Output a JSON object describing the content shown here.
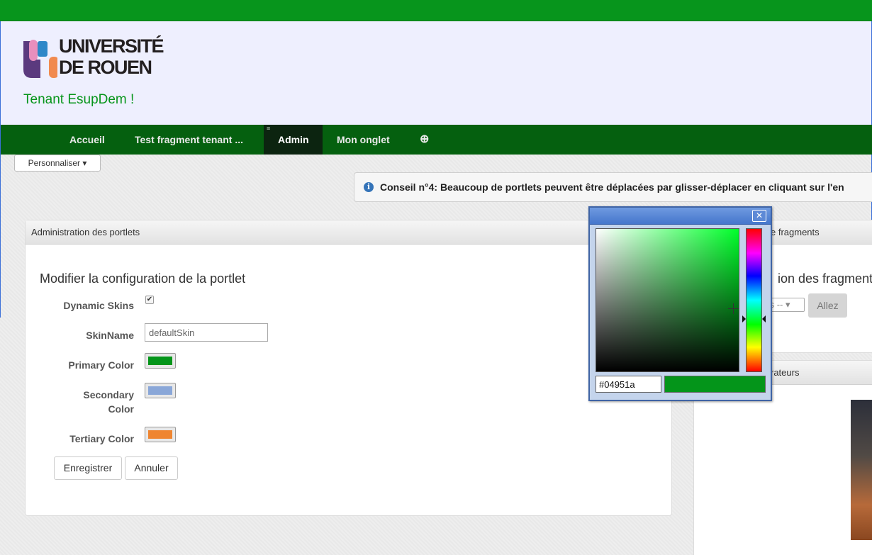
{
  "header": {
    "logo_line1": "UNIVERSITÉ",
    "logo_line2": "DE ROUEN",
    "tenant": "Tenant EsupDem !"
  },
  "nav": {
    "tabs": [
      {
        "label": "Accueil"
      },
      {
        "label": "Test fragment tenant ..."
      },
      {
        "label": "Admin",
        "active": true
      },
      {
        "label": "Mon onglet"
      },
      {
        "label": "⊕"
      }
    ]
  },
  "personalize_button": "Personnaliser ▾",
  "tip": "Conseil n°4: Beaucoup de portlets peuvent être déplacées par glisser-déplacer en cliquant sur l'en",
  "portlet_admin": {
    "header": "Administration des portlets",
    "title": "Modifier la configuration de la portlet",
    "fields": {
      "dynamic_skins": {
        "label": "Dynamic Skins",
        "checked": true
      },
      "skin_name": {
        "label": "SkinName",
        "value": "defaultSkin"
      },
      "primary_color": {
        "label": "Primary Color",
        "value": "#04951a"
      },
      "secondary_color": {
        "label": "Secondary Color",
        "value": "#8aa7d8"
      },
      "tertiary_color": {
        "label": "Tertiary Color",
        "value": "#ef8530"
      }
    },
    "save": "Enregistrer",
    "cancel": "Annuler"
  },
  "fragments_panel": {
    "header": "e fragments",
    "title": "ion des fragments",
    "select_value": "ts -- ▾",
    "go": "Allez"
  },
  "admins_panel": {
    "header": "rateurs"
  },
  "color_picker": {
    "close": "✕",
    "hex": "#04951a",
    "preview_color": "#04951a"
  },
  "colors": {
    "topbar": "#07951c",
    "nav": "#05600f",
    "accent": "#07951c"
  }
}
